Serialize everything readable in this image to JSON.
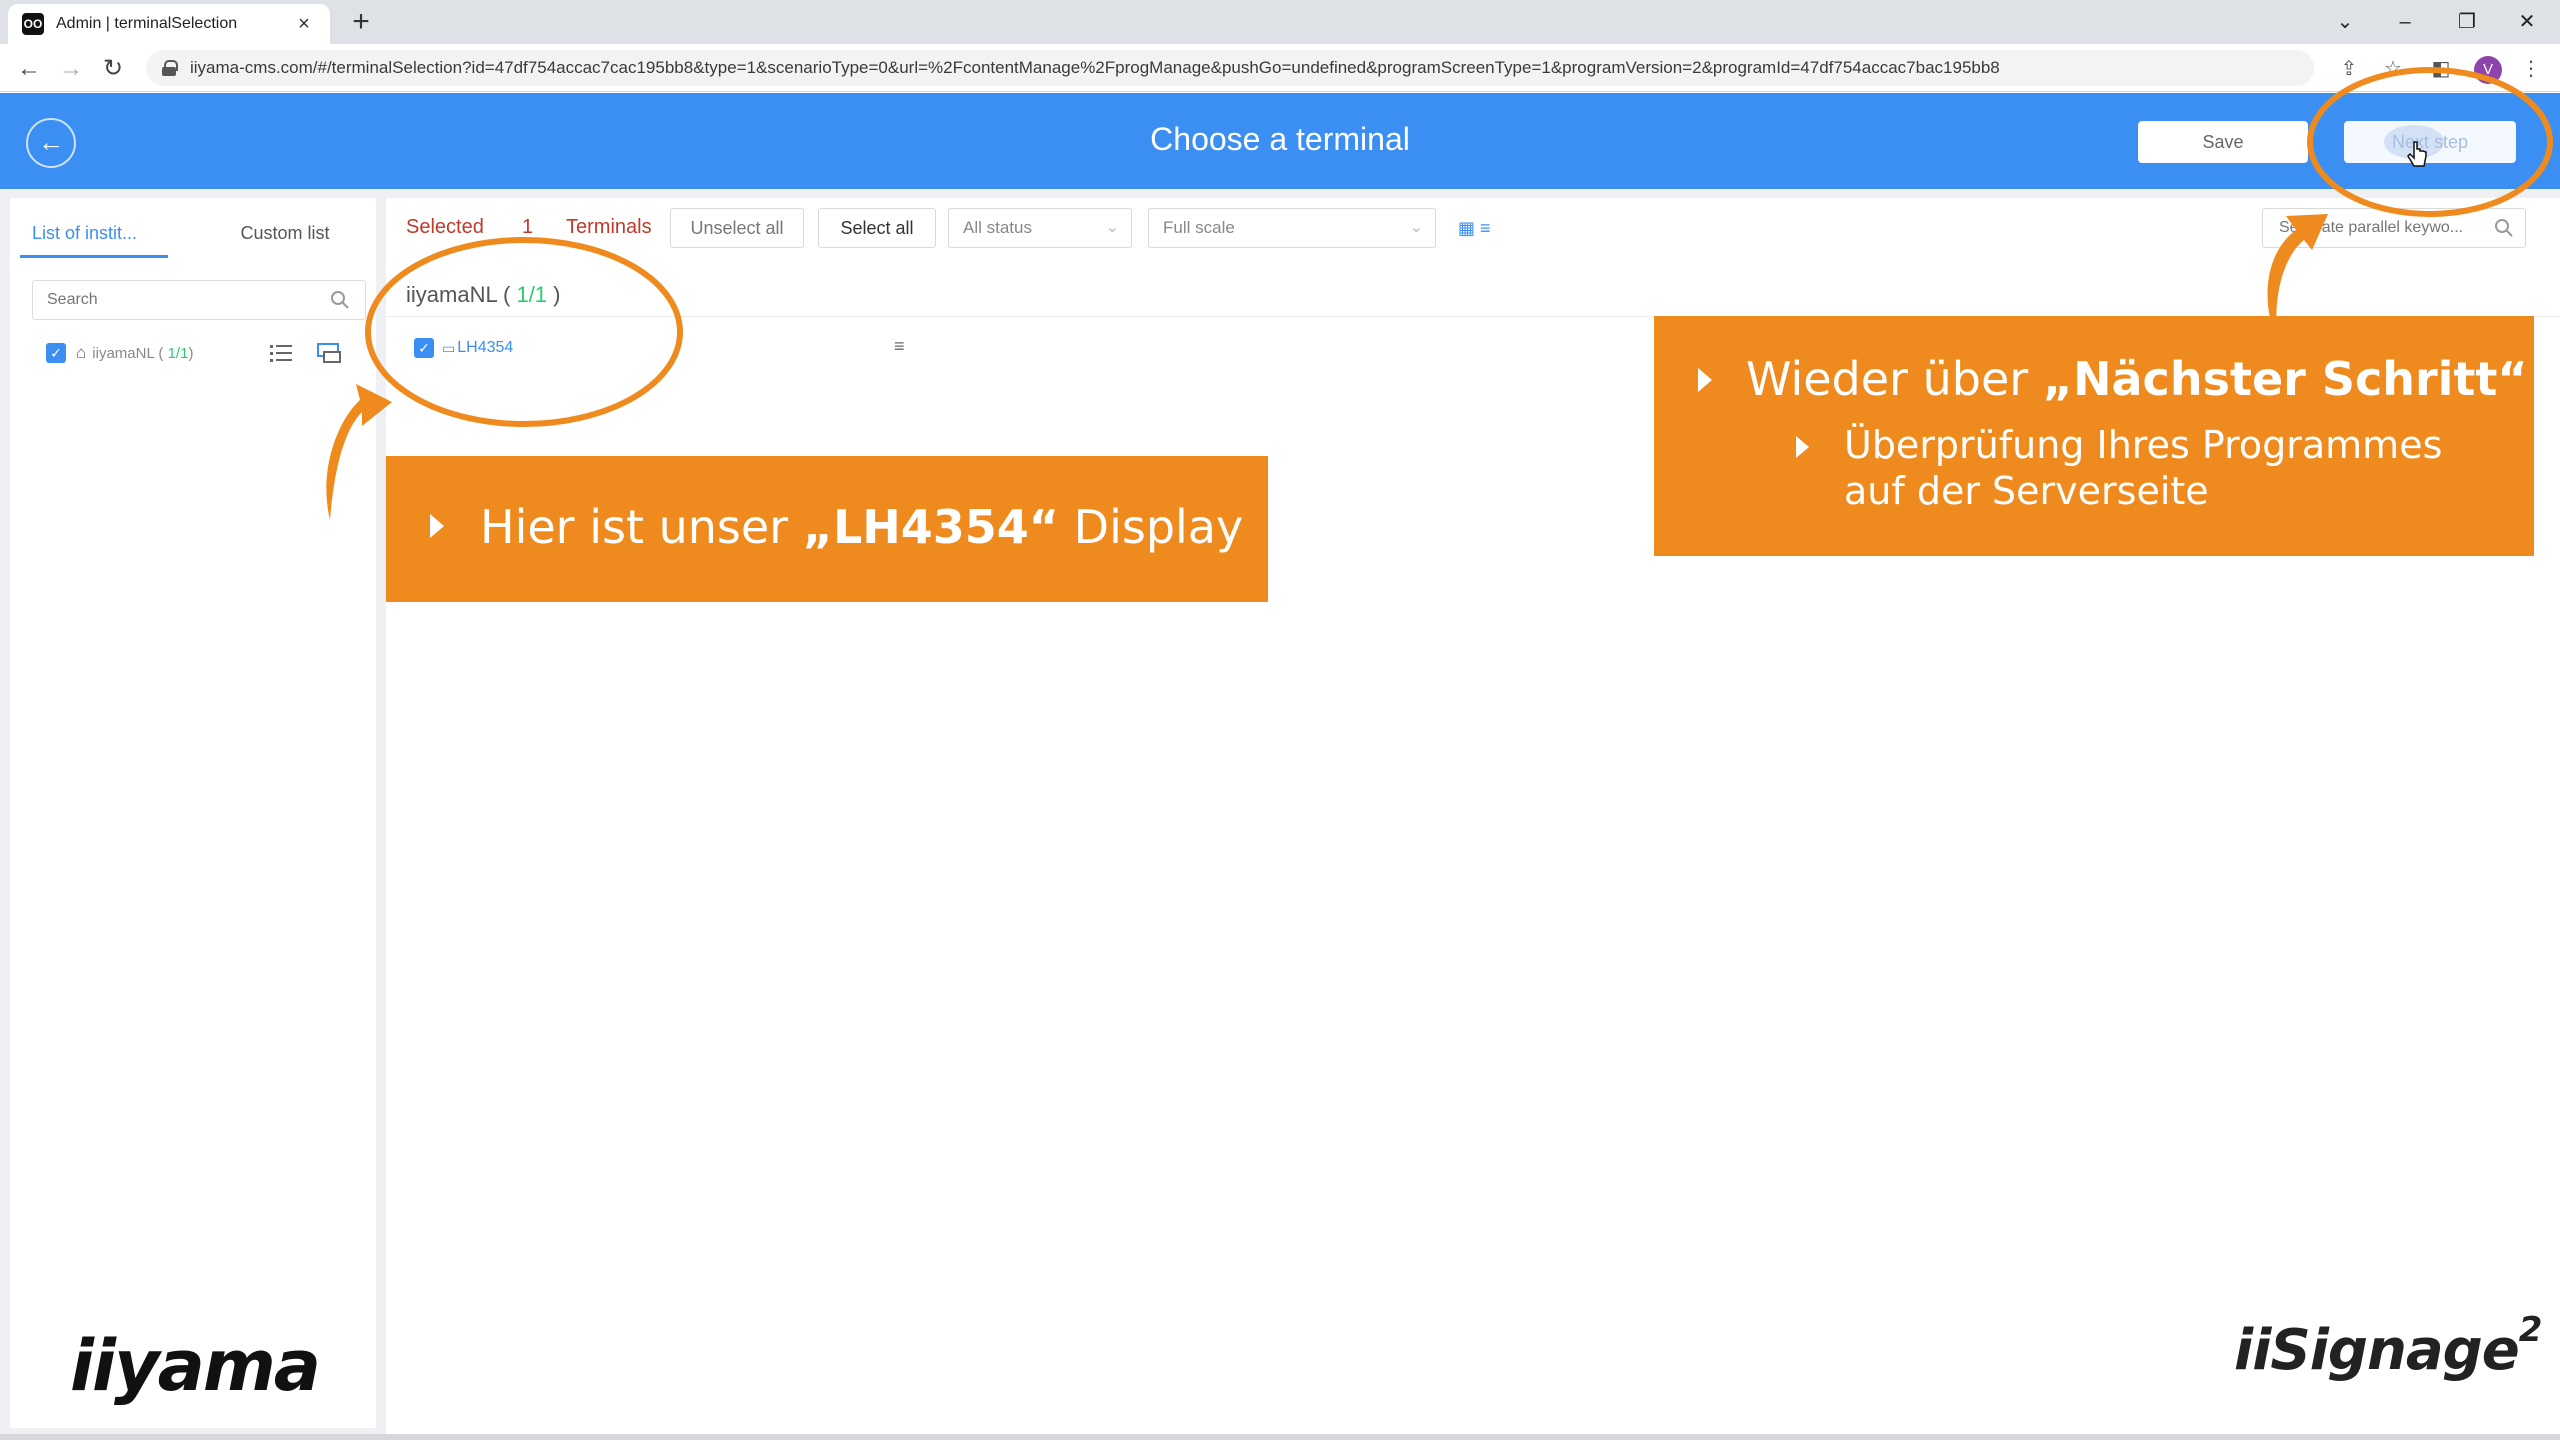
{
  "browser": {
    "tab_title": "Admin | terminalSelection",
    "favicon_text": "OO",
    "new_tab": "+",
    "url": "iiyama-cms.com/#/terminalSelection?id=47df754accac7cac195bb8&type=1&scenarioType=0&url=%2FcontentManage%2FprogManage&pushGo=undefined&programScreenType=1&programVersion=2&programId=47df754accac7bac195bb8",
    "profile_initial": "V"
  },
  "header": {
    "title": "Choose a terminal",
    "save_label": "Save",
    "next_label": "Next step"
  },
  "sidebar": {
    "tabs": [
      "List of instit...",
      "Custom list"
    ],
    "search_placeholder": "Search",
    "tree": [
      {
        "label": "iiyamaNL",
        "count": "1/1",
        "checked": true
      }
    ]
  },
  "toolbar": {
    "selected_label": "Selected",
    "selected_count": "1",
    "terminals_label": "Terminals",
    "unselect_all": "Unselect all",
    "select_all": "Select all",
    "status_filter": "All status",
    "scale_filter": "Full scale",
    "keyword_placeholder": "Separate parallel keywo..."
  },
  "group": {
    "name": "iiyamaNL",
    "count": "1/1",
    "terminals": [
      {
        "name": "LH4354",
        "checked": true
      }
    ]
  },
  "annotations": {
    "callout1": {
      "prefix": "Hier ist unser ",
      "emphasis": "„LH4354“",
      "suffix": " Display"
    },
    "callout2": {
      "line1_prefix": "Wieder über ",
      "line1_emphasis": "„Nächster Schritt“",
      "line2": "Überprüfung Ihres Programmes auf der Serverseite"
    }
  },
  "logos": {
    "left": "iiyama",
    "right": "iiSignage",
    "right_sup": "2"
  },
  "colors": {
    "accent": "#3b8ff2",
    "callout": "#ef8b1e",
    "selected_text": "#c0392b",
    "count_green": "#2ecc71"
  }
}
